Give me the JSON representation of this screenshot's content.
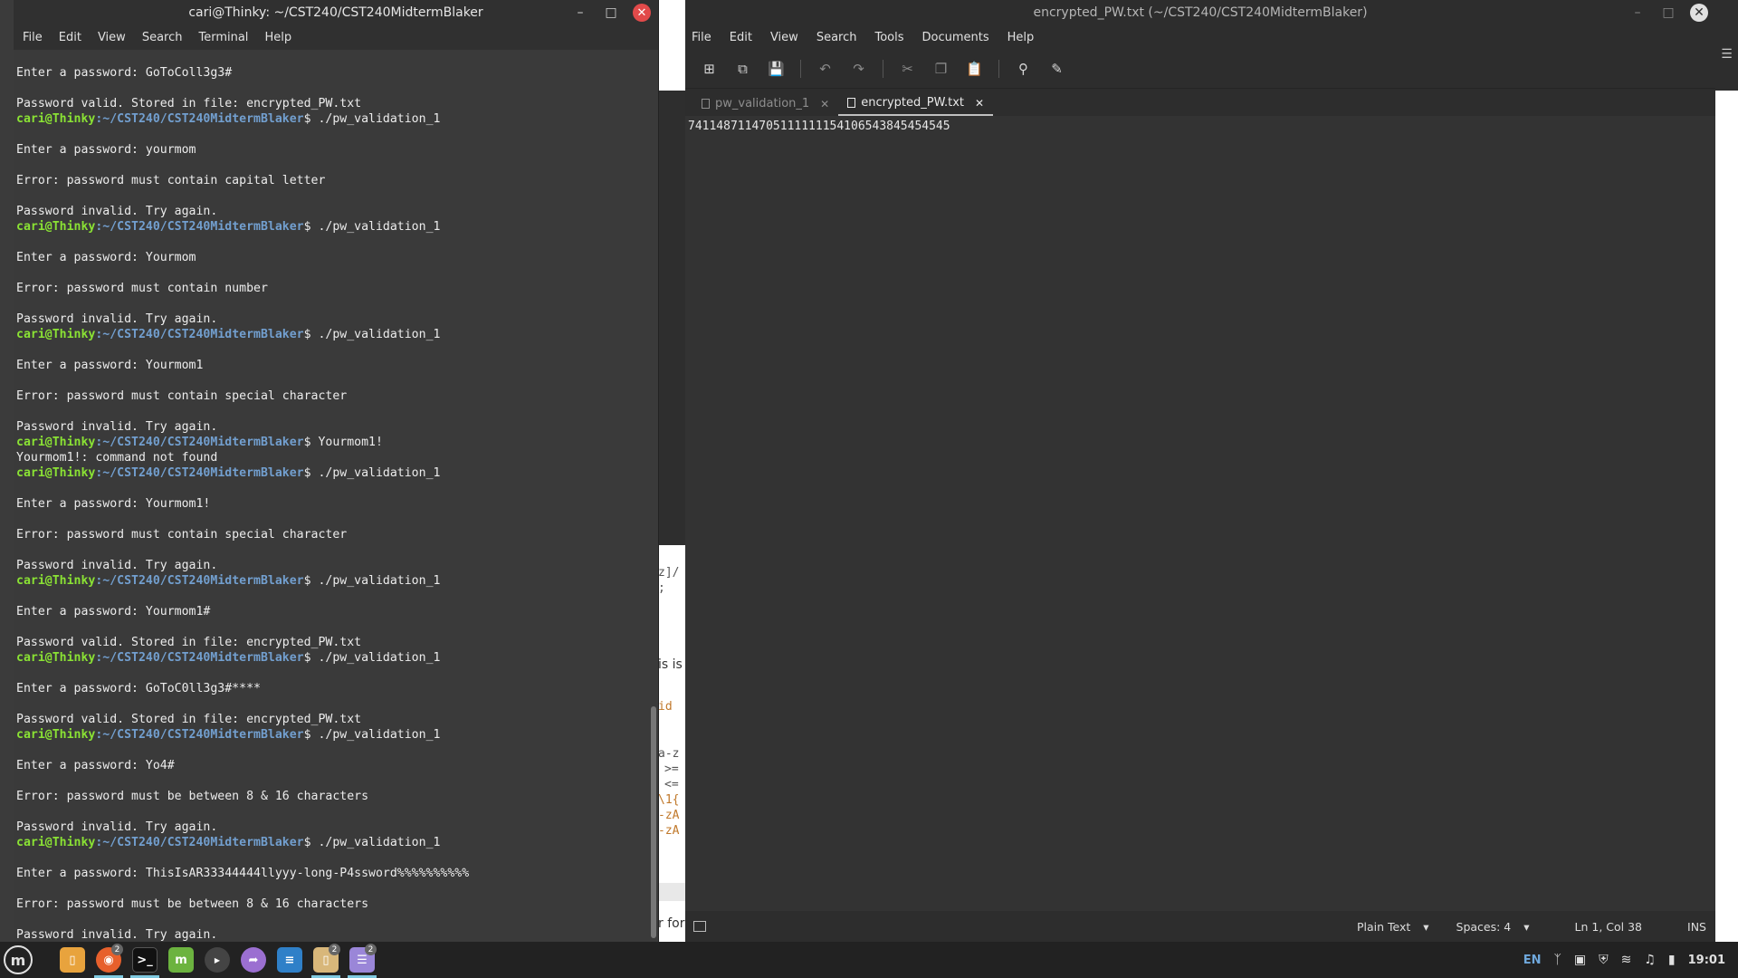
{
  "terminal": {
    "title": "cari@Thinky: ~/CST240/CST240MidtermBlaker",
    "menu": [
      "File",
      "Edit",
      "View",
      "Search",
      "Terminal",
      "Help"
    ],
    "prompt_user": "cari@Thinky",
    "prompt_path": ":~/CST240/CST240MidtermBlaker",
    "lines": [
      {
        "t": "Enter a password: GoToColl3g3#"
      },
      {
        "t": ""
      },
      {
        "t": "Password valid. Stored in file: encrypted_PW.txt"
      },
      {
        "p": true,
        "cmd": "$ ./pw_validation_1"
      },
      {
        "t": ""
      },
      {
        "t": "Enter a password: yourmom"
      },
      {
        "t": ""
      },
      {
        "t": "Error: password must contain capital letter"
      },
      {
        "t": ""
      },
      {
        "t": "Password invalid. Try again."
      },
      {
        "p": true,
        "cmd": "$ ./pw_validation_1"
      },
      {
        "t": ""
      },
      {
        "t": "Enter a password: Yourmom"
      },
      {
        "t": ""
      },
      {
        "t": "Error: password must contain number"
      },
      {
        "t": ""
      },
      {
        "t": "Password invalid. Try again."
      },
      {
        "p": true,
        "cmd": "$ ./pw_validation_1"
      },
      {
        "t": ""
      },
      {
        "t": "Enter a password: Yourmom1"
      },
      {
        "t": ""
      },
      {
        "t": "Error: password must contain special character"
      },
      {
        "t": ""
      },
      {
        "t": "Password invalid. Try again."
      },
      {
        "p": true,
        "cmd": "$ Yourmom1!"
      },
      {
        "t": "Yourmom1!: command not found"
      },
      {
        "p": true,
        "cmd": "$ ./pw_validation_1"
      },
      {
        "t": ""
      },
      {
        "t": "Enter a password: Yourmom1!"
      },
      {
        "t": ""
      },
      {
        "t": "Error: password must contain special character"
      },
      {
        "t": ""
      },
      {
        "t": "Password invalid. Try again."
      },
      {
        "p": true,
        "cmd": "$ ./pw_validation_1"
      },
      {
        "t": ""
      },
      {
        "t": "Enter a password: Yourmom1#"
      },
      {
        "t": ""
      },
      {
        "t": "Password valid. Stored in file: encrypted_PW.txt"
      },
      {
        "p": true,
        "cmd": "$ ./pw_validation_1"
      },
      {
        "t": ""
      },
      {
        "t": "Enter a password: GoToC0ll3g3#****"
      },
      {
        "t": ""
      },
      {
        "t": "Password valid. Stored in file: encrypted_PW.txt"
      },
      {
        "p": true,
        "cmd": "$ ./pw_validation_1"
      },
      {
        "t": ""
      },
      {
        "t": "Enter a password: Yo4#"
      },
      {
        "t": ""
      },
      {
        "t": "Error: password must be between 8 & 16 characters"
      },
      {
        "t": ""
      },
      {
        "t": "Password invalid. Try again."
      },
      {
        "p": true,
        "cmd": "$ ./pw_validation_1"
      },
      {
        "t": ""
      },
      {
        "t": "Enter a password: ThisIsAR33344444llyyy-long-P4ssword%%%%%%%%%%"
      },
      {
        "t": ""
      },
      {
        "t": "Error: password must be between 8 & 16 characters"
      },
      {
        "t": ""
      },
      {
        "t": "Password invalid. Try again."
      }
    ]
  },
  "background_window": {
    "fragments": [
      "z]/",
      ";",
      "is is",
      "id",
      "a-z",
      ">=",
      "<=",
      "\\1{",
      "-zA",
      "-zA",
      "r for"
    ]
  },
  "editor": {
    "title": "encrypted_PW.txt (~/CST240/CST240MidtermBlaker)",
    "menu": [
      "File",
      "Edit",
      "View",
      "Search",
      "Tools",
      "Documents",
      "Help"
    ],
    "tabs": [
      {
        "label": "pw_validation_1",
        "active": false
      },
      {
        "label": "encrypted_PW.txt",
        "active": true
      }
    ],
    "content": "7411487114705111111154106543845454545",
    "status": {
      "language": "Plain Text",
      "spaces": "Spaces: 4",
      "position": "Ln 1, Col 38",
      "mode": "INS"
    }
  },
  "taskbar": {
    "apps": [
      {
        "name": "files",
        "badge": ""
      },
      {
        "name": "firefox",
        "badge": "2"
      },
      {
        "name": "terminal",
        "badge": ""
      },
      {
        "name": "mint-update",
        "badge": ""
      },
      {
        "name": "xplayer",
        "badge": ""
      },
      {
        "name": "share",
        "badge": ""
      },
      {
        "name": "text-editor",
        "badge": ""
      },
      {
        "name": "file-manager",
        "badge": "2"
      },
      {
        "name": "xed",
        "badge": "2"
      }
    ],
    "tray": {
      "language": "EN",
      "clock": "19:01"
    }
  },
  "colors": {
    "prompt_user": "#8ae234",
    "prompt_path": "#729fcf",
    "close_button": "#e24a4a"
  }
}
